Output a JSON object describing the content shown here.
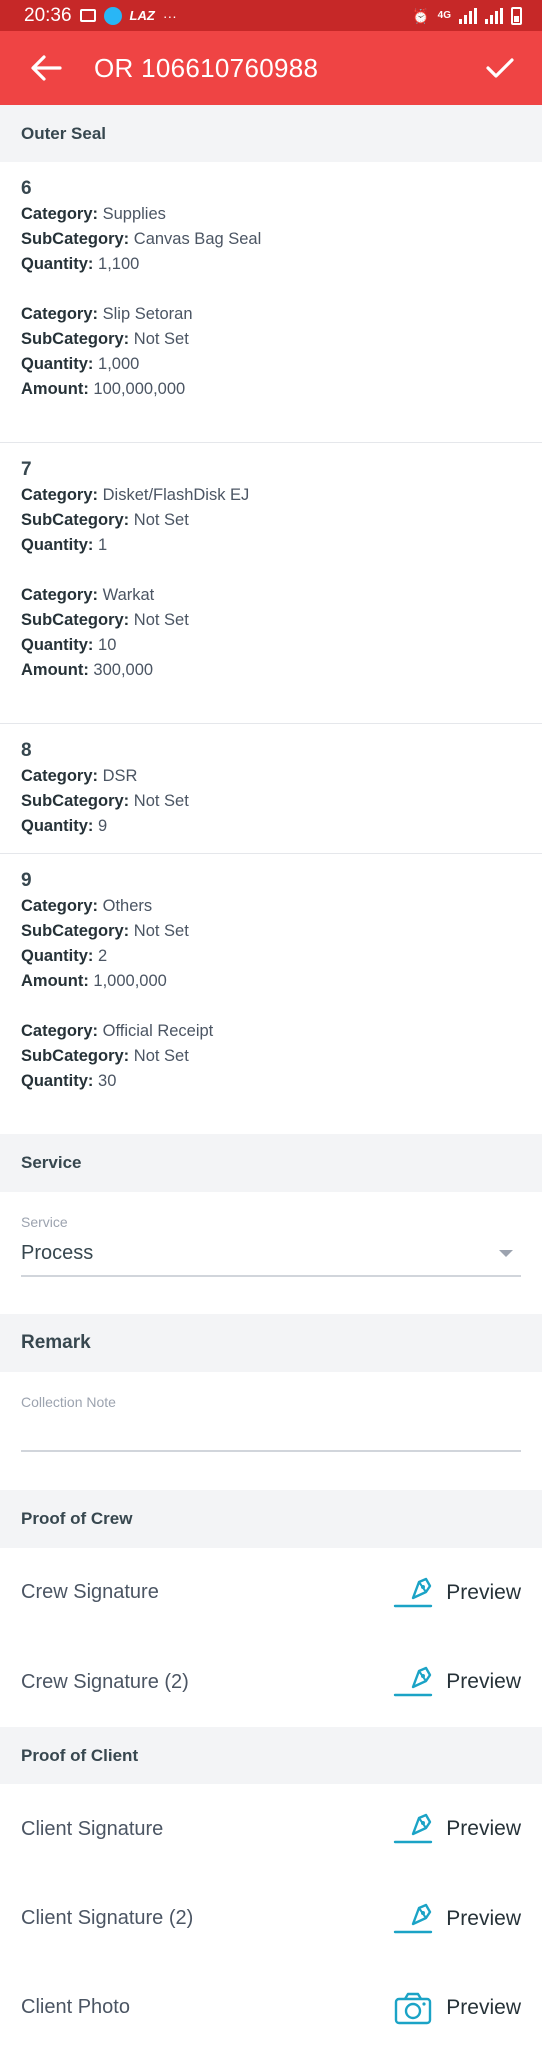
{
  "status_bar": {
    "time": "20:36",
    "carrier_text": "LAZ",
    "more": "···",
    "network": "4G"
  },
  "app_bar": {
    "title": "OR 106610760988"
  },
  "outer_seal": {
    "header": "Outer Seal",
    "items": [
      {
        "number": "6",
        "groups": [
          {
            "category": "Supplies",
            "subcategory": "Canvas Bag Seal",
            "quantity": "1,100"
          },
          {
            "category": "Slip Setoran",
            "subcategory": "Not Set",
            "quantity": "1,000",
            "amount": "100,000,000"
          }
        ]
      },
      {
        "number": "7",
        "groups": [
          {
            "category": "Disket/FlashDisk EJ",
            "subcategory": "Not Set",
            "quantity": "1"
          },
          {
            "category": "Warkat",
            "subcategory": "Not Set",
            "quantity": "10",
            "amount": "300,000"
          }
        ]
      },
      {
        "number": "8",
        "groups": [
          {
            "category": "DSR",
            "subcategory": "Not Set",
            "quantity": "9"
          }
        ]
      },
      {
        "number": "9",
        "groups": [
          {
            "category": "Others",
            "subcategory": "Not Set",
            "quantity": "2",
            "amount": "1,000,000"
          },
          {
            "category": "Official Receipt",
            "subcategory": "Not Set",
            "quantity": "30"
          }
        ]
      }
    ]
  },
  "labels": {
    "category": "Category:",
    "subcategory": "SubCategory:",
    "quantity": "Quantity:",
    "amount": "Amount:"
  },
  "service": {
    "header": "Service",
    "field_label": "Service",
    "selected": "Process"
  },
  "remark": {
    "header": "Remark",
    "placeholder": "Collection Note",
    "value": ""
  },
  "proof_of_crew": {
    "header": "Proof of Crew",
    "rows": [
      {
        "label": "Crew Signature",
        "action": "Preview",
        "icon": "signature-icon"
      },
      {
        "label": "Crew Signature (2)",
        "action": "Preview",
        "icon": "signature-icon"
      }
    ]
  },
  "proof_of_client": {
    "header": "Proof of Client",
    "rows": [
      {
        "label": "Client Signature",
        "action": "Preview",
        "icon": "signature-icon"
      },
      {
        "label": "Client Signature (2)",
        "action": "Preview",
        "icon": "signature-icon"
      },
      {
        "label": "Client Photo",
        "action": "Preview",
        "icon": "camera-icon"
      }
    ]
  },
  "colors": {
    "status_bar": "#c62828",
    "app_bar": "#ef4444",
    "icon_accent": "#1ba3c6",
    "section_bg": "#f3f4f6"
  }
}
